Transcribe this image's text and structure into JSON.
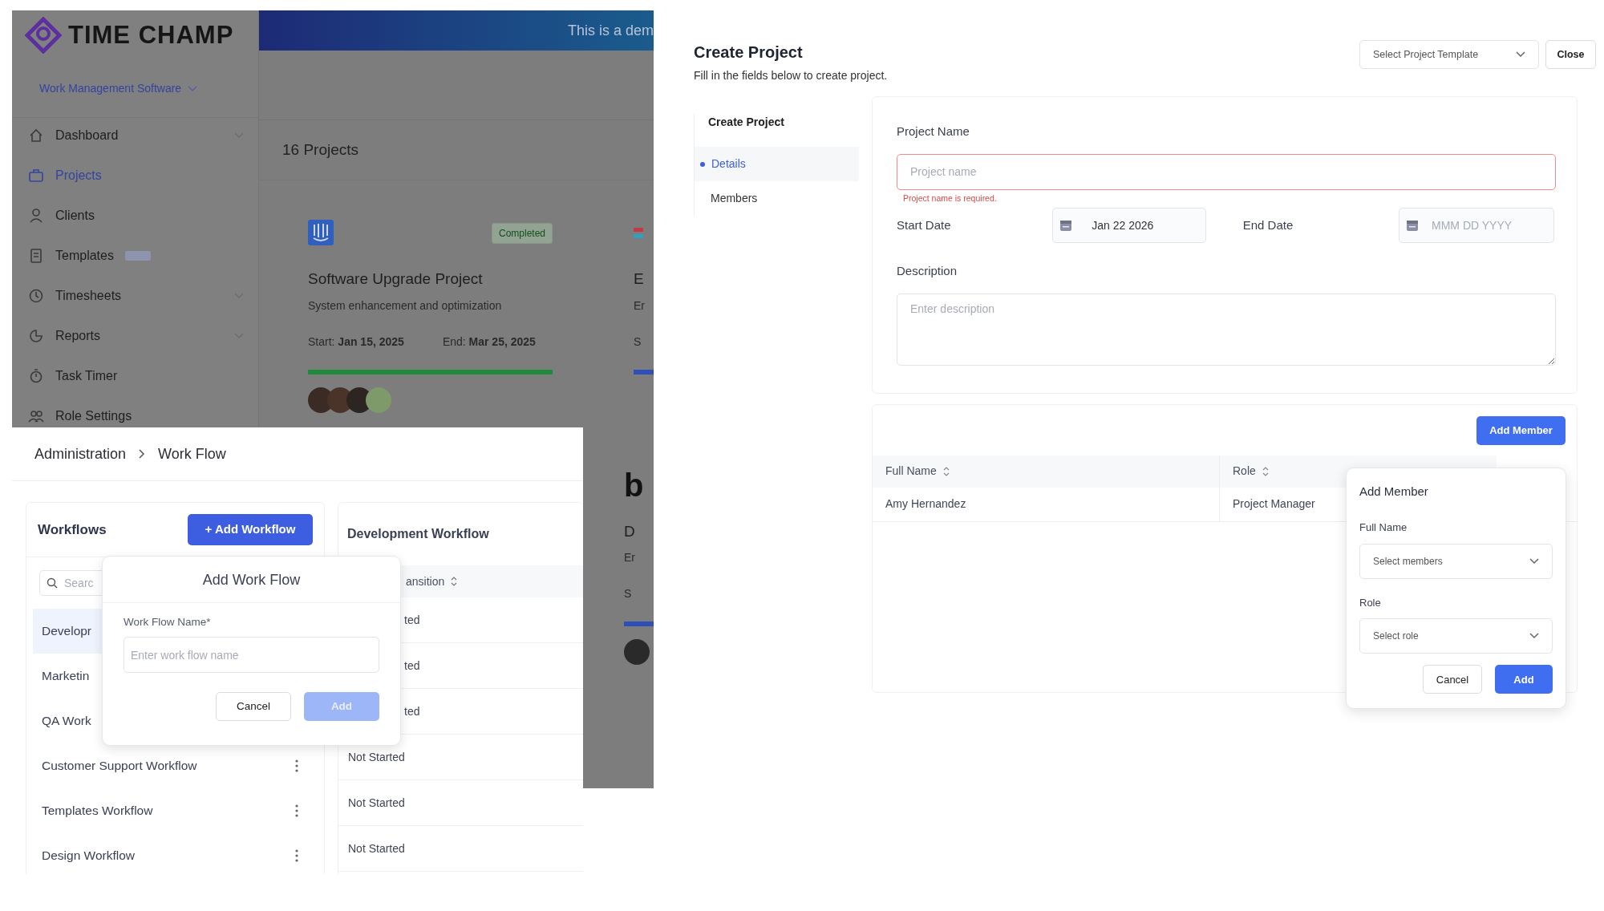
{
  "dashboard": {
    "logo": "TIME CHAMP",
    "banner": "This is a dem",
    "workspace": "Work Management Software",
    "nav": [
      {
        "label": "Dashboard",
        "selected": false,
        "expandable": true,
        "tagged": false
      },
      {
        "label": "Projects",
        "selected": true,
        "expandable": false,
        "tagged": false
      },
      {
        "label": "Clients",
        "selected": false,
        "expandable": false,
        "tagged": false
      },
      {
        "label": "Templates",
        "selected": false,
        "expandable": false,
        "tagged": true
      },
      {
        "label": "Timesheets",
        "selected": false,
        "expandable": true,
        "tagged": false
      },
      {
        "label": "Reports",
        "selected": false,
        "expandable": true,
        "tagged": false
      },
      {
        "label": "Task Timer",
        "selected": false,
        "expandable": false,
        "tagged": false
      },
      {
        "label": "Role Settings",
        "selected": false,
        "expandable": false,
        "tagged": false
      }
    ],
    "heading": "16 Projects",
    "cards": [
      {
        "kind": "full",
        "color": "#1f8a3a",
        "status": "Completed",
        "title": "Software Upgrade Project",
        "description": "System enhancement and optimization",
        "start": "Start: **Jan 15, 2025**",
        "end": "End: **Mar 25, 2025**",
        "level": 1
      },
      {
        "kind": "partial",
        "color": "#2e4fb8",
        "title": "E",
        "description": "Er",
        "dates": "S"
      }
    ],
    "lower_card": {
      "title": "b",
      "subtitle": "D",
      "description": "Er",
      "dates": "S"
    }
  },
  "workflow": {
    "breadcrumb": [
      "Administration",
      "Work Flow"
    ],
    "list_title": "Workflows",
    "add_button": "+ Add Workflow",
    "search_placeholder": "Searc",
    "workflows": [
      {
        "label": "Developr",
        "selected": true
      },
      {
        "label": "Marketin",
        "selected": false
      },
      {
        "label": "QA Work",
        "selected": false
      },
      {
        "label": "Customer Support Workflow",
        "selected": false,
        "menu": true
      },
      {
        "label": "Templates Workflow",
        "selected": false,
        "menu": true
      },
      {
        "label": "Design Workflow",
        "selected": false,
        "menu": true
      }
    ],
    "detail_title": "Development Workflow",
    "column": {
      "label": "ansition",
      "kind": "clipped"
    },
    "rows": [
      {
        "text": "ted",
        "kind": "clipped"
      },
      {
        "text": "ted",
        "kind": "clipped"
      },
      {
        "text": "ted",
        "kind": "clipped"
      },
      {
        "text": "Not Started",
        "kind": "full"
      },
      {
        "text": "Not Started",
        "kind": "full"
      },
      {
        "text": "Not Started",
        "kind": "full"
      }
    ],
    "modal": {
      "title": "Add Work Flow",
      "label": "Work Flow Name*",
      "placeholder": "Enter work flow name",
      "buttons": [
        {
          "label": "Cancel",
          "kind": "secondary",
          "disabled": false
        },
        {
          "label": "Add",
          "kind": "primary",
          "disabled": true
        }
      ]
    }
  },
  "create": {
    "title": "Create Project",
    "subtitle": "Fill in the fields below to create project.",
    "template_placeholder": "Select Project Template",
    "close": "Close",
    "steps_title": "Create Project",
    "steps": [
      {
        "label": "Details",
        "selected": true
      },
      {
        "label": "Members",
        "selected": false
      }
    ],
    "project_name": {
      "label": "Project Name",
      "placeholder": "Project name",
      "invalid": true,
      "error": "Project name is required."
    },
    "start_date": {
      "label": "Start Date",
      "value": "Jan 22 2026"
    },
    "end_date": {
      "label": "End Date",
      "placeholder": "MMM DD YYYY"
    },
    "description": {
      "label": "Description",
      "placeholder": "Enter description"
    },
    "add_member_button": "Add Member",
    "columns": [
      {
        "label": "Full Name",
        "sortable": true
      },
      {
        "label": "Role",
        "sortable": true
      }
    ],
    "rows": [
      [
        "Amy Hernandez",
        "Project Manager"
      ]
    ],
    "popover": {
      "title": "Add Member",
      "fields": [
        {
          "label": "Full Name",
          "placeholder": "Select members"
        },
        {
          "label": "Role",
          "placeholder": "Select role"
        }
      ],
      "buttons": [
        {
          "label": "Cancel",
          "kind": "secondary"
        },
        {
          "label": "Add",
          "kind": "primary"
        }
      ]
    }
  }
}
